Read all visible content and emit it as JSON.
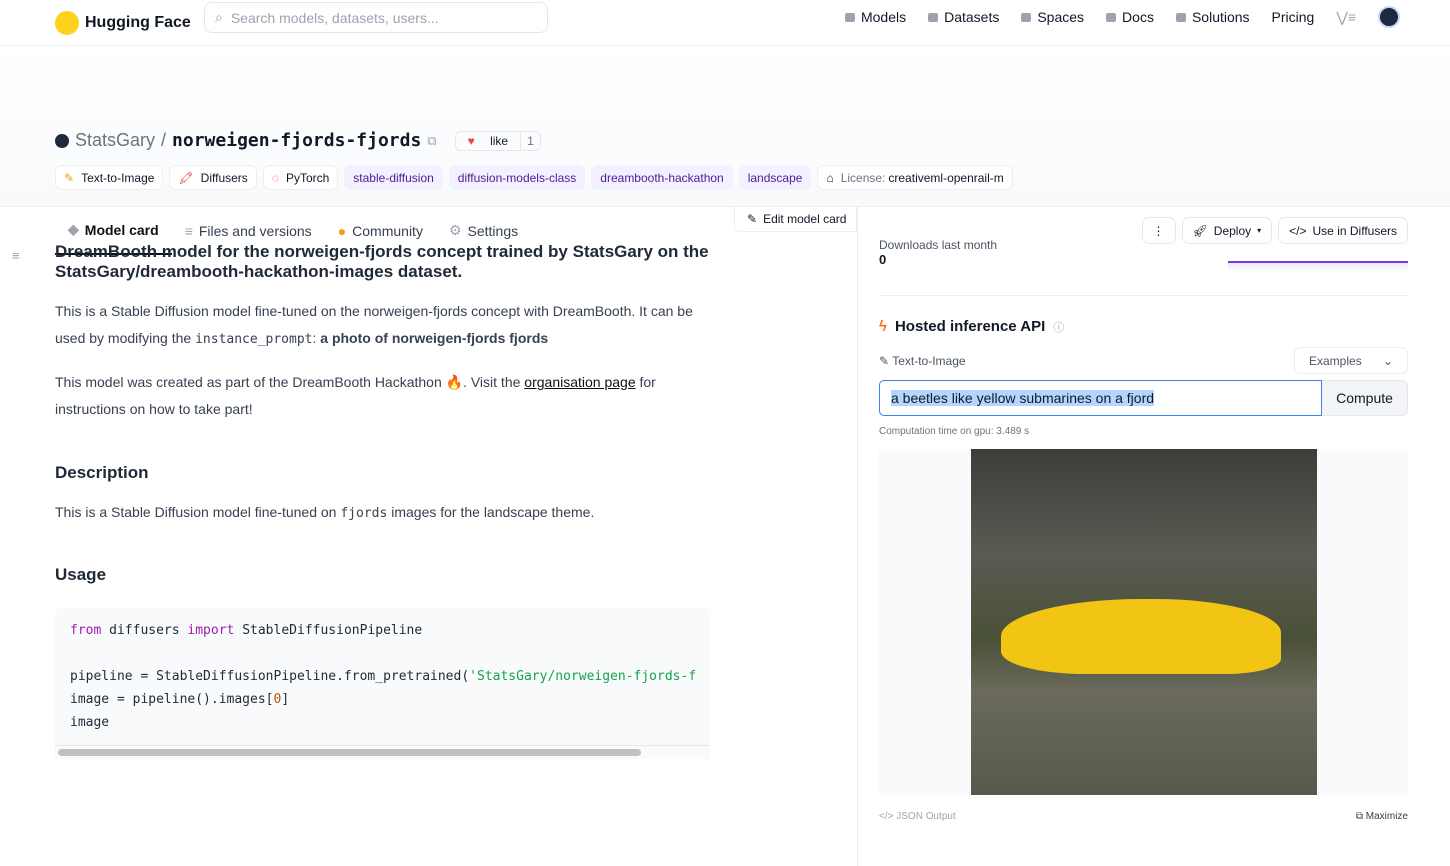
{
  "nav": {
    "brand": "Hugging Face",
    "search_placeholder": "Search models, datasets, users...",
    "links": [
      "Models",
      "Datasets",
      "Spaces",
      "Docs",
      "Solutions",
      "Pricing"
    ]
  },
  "repo": {
    "owner": "StatsGary",
    "separator": "/",
    "name": "norweigen-fjords-fjords",
    "like_label": "like",
    "like_count": "1"
  },
  "tags": [
    {
      "label": "Text-to-Image"
    },
    {
      "label": "Diffusers"
    },
    {
      "label": "PyTorch"
    },
    {
      "label": "stable-diffusion"
    },
    {
      "label": "diffusion-models-class"
    },
    {
      "label": "dreambooth-hackathon"
    },
    {
      "label": "landscape"
    },
    {
      "label_prefix": "License:",
      "label": "creativeml-openrail-m"
    }
  ],
  "tabs": [
    "Model card",
    "Files and versions",
    "Community",
    "Settings"
  ],
  "actions": {
    "more": "⋮",
    "deploy": "Deploy",
    "use": "Use in Diffusers"
  },
  "edit_label": "Edit model card",
  "card": {
    "heading": "DreamBooth model for the norweigen-fjords concept trained by StatsGary on the StatsGary/dreambooth-hackathon-images dataset.",
    "p1a": "This is a Stable Diffusion model fine-tuned on the norweigen-fjords concept with DreamBooth. It can be used by modifying the ",
    "p1code": "instance_prompt",
    "p1b": ": ",
    "p1bold": "a photo of norweigen-fjords fjords",
    "p2a": "This model was created as part of the DreamBooth Hackathon 🔥. Visit the ",
    "p2link": "organisation page",
    "p2b": " for instructions on how to take part!",
    "desc_heading": "Description",
    "desc_a": "This is a Stable Diffusion model fine-tuned on ",
    "desc_code": "fjords",
    "desc_b": " images for the landscape theme.",
    "usage_heading": "Usage",
    "code": {
      "l1a": "from",
      "l1b": " diffusers ",
      "l1c": "import",
      "l1d": " StableDiffusionPipeline",
      "l2a": "pipeline = StableDiffusionPipeline.from_pretrained(",
      "l2b": "'StatsGary/norweigen-fjords-f",
      "l3a": "image = pipeline().images[",
      "l3b": "0",
      "l3c": "]",
      "l4": "image"
    }
  },
  "side": {
    "downloads_label": "Downloads last month",
    "downloads_value": "0",
    "api_title": "Hosted inference API",
    "task": "Text-to-Image",
    "examples": "Examples",
    "input_value": "a beetles like yellow submarines on a fjord",
    "compute": "Compute",
    "comp_time": "Computation time on gpu: 3.489 s",
    "json_output": "JSON Output",
    "maximize": "Maximize"
  },
  "colors": {
    "accent": "#7c3aed",
    "tag_bg": "#f3f0ff",
    "like": "#ef4444"
  }
}
